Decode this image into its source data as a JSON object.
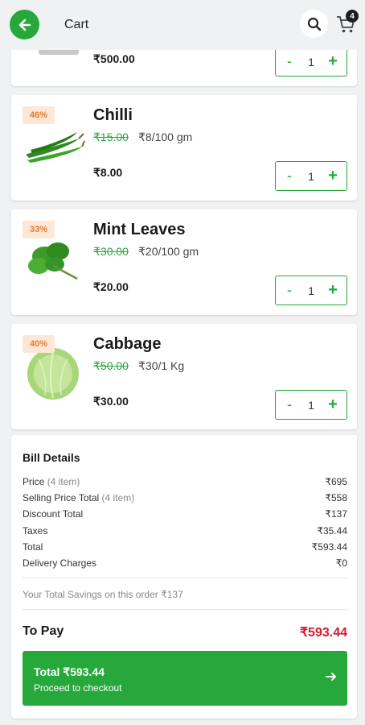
{
  "header": {
    "title": "Cart",
    "cart_count": "4",
    "back_icon": "arrow-left-icon",
    "search_icon": "search-icon",
    "cart_icon": "cart-icon"
  },
  "items": [
    {
      "price": "₹500.00",
      "qty": "1"
    },
    {
      "name": "Chilli",
      "discount": "46%",
      "mrp": "₹15.00",
      "unit_price": "₹8/100 gm",
      "price": "₹8.00",
      "qty": "1"
    },
    {
      "name": "Mint Leaves",
      "discount": "33%",
      "mrp": "₹30.00",
      "unit_price": "₹20/100 gm",
      "price": "₹20.00",
      "qty": "1"
    },
    {
      "name": "Cabbage",
      "discount": "40%",
      "mrp": "₹50.00",
      "unit_price": "₹30/1 Kg",
      "price": "₹30.00",
      "qty": "1"
    }
  ],
  "stepper": {
    "minus": "-",
    "plus": "+"
  },
  "bill": {
    "title": "Bill Details",
    "rows": [
      {
        "label": "Price",
        "note": "(4 item)",
        "value": "₹695"
      },
      {
        "label": "Selling Price Total",
        "note": "(4 item)",
        "value": "₹558"
      },
      {
        "label": "Discount Total",
        "note": "",
        "value": "₹137"
      },
      {
        "label": "Taxes",
        "note": "",
        "value": "₹35.44"
      },
      {
        "label": "Total",
        "note": "",
        "value": "₹593.44"
      },
      {
        "label": "Delivery Charges",
        "note": "",
        "value": "₹0"
      }
    ],
    "savings": "Your Total Savings on this order ₹137",
    "to_pay_label": "To Pay",
    "to_pay_value": "₹593.44"
  },
  "checkout": {
    "total": "Total ₹593.44",
    "subtitle": "Proceed to checkout"
  },
  "colors": {
    "accent": "#27a83b",
    "pay": "#d51a2a",
    "badge_bg": "#fde7d7",
    "badge_text": "#e87a2a"
  }
}
